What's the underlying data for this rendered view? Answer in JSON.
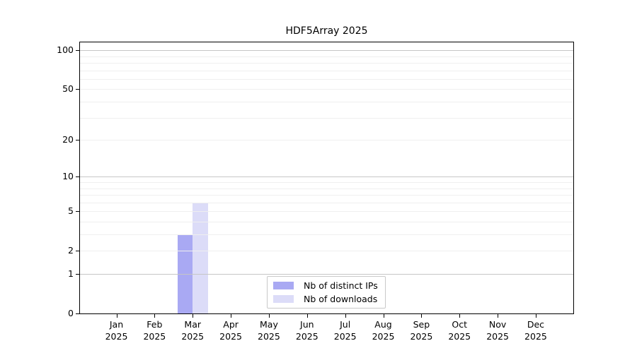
{
  "chart_data": {
    "type": "bar",
    "title": "HDF5Array 2025",
    "year_label": "2025",
    "categories": [
      "Jan",
      "Feb",
      "Mar",
      "Apr",
      "May",
      "Jun",
      "Jul",
      "Aug",
      "Sep",
      "Oct",
      "Nov",
      "Dec"
    ],
    "series": [
      {
        "name": "Nb of distinct IPs",
        "color": "#a9a9f3",
        "values": [
          0,
          0,
          3,
          0,
          0,
          0,
          0,
          0,
          0,
          0,
          0,
          0
        ]
      },
      {
        "name": "Nb of downloads",
        "color": "#dcdcf8",
        "values": [
          0,
          0,
          6,
          0,
          0,
          0,
          0,
          0,
          0,
          0,
          0,
          0
        ]
      }
    ],
    "yscale": "log1p",
    "ylim": [
      0,
      115
    ],
    "yticks": [
      0,
      1,
      2,
      5,
      10,
      20,
      50,
      100
    ],
    "grid": {
      "minor": [
        2,
        3,
        4,
        5,
        6,
        7,
        8,
        9,
        20,
        30,
        40,
        50,
        60,
        70,
        80,
        90
      ],
      "major": [
        1,
        10,
        100
      ]
    },
    "colors": {
      "grid_minor": "#efefef",
      "grid_major": "#c6c6c6",
      "axis": "#000000",
      "background": "#ffffff"
    },
    "legend_position": "bottom-center",
    "grid_on_top_of_bars": true
  }
}
